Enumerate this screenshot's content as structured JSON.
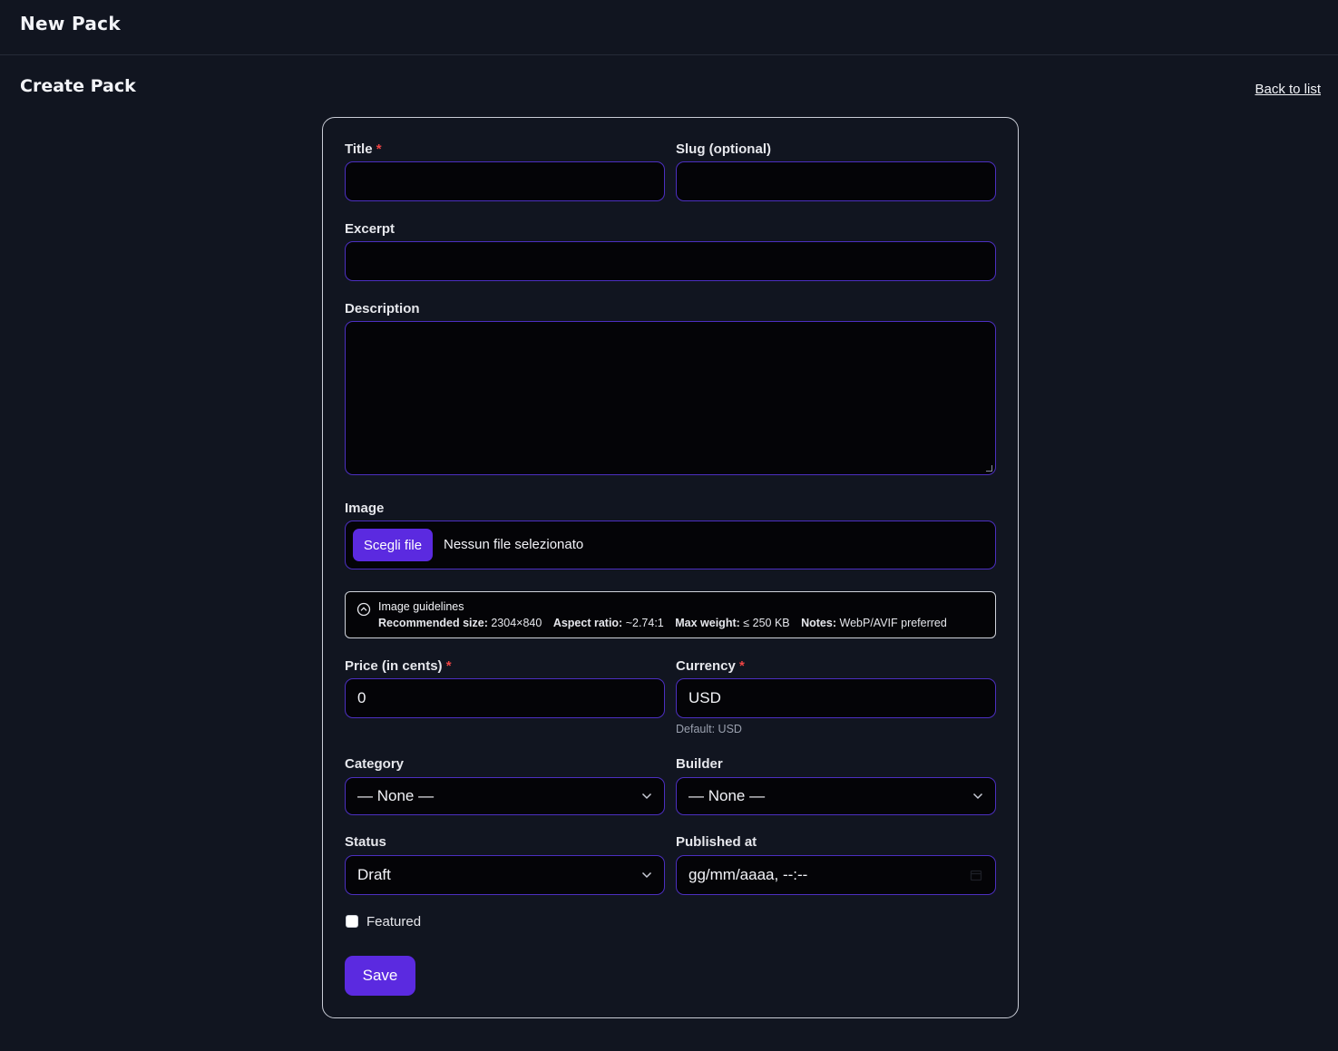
{
  "header": {
    "title": "New Pack"
  },
  "page": {
    "title": "Create Pack",
    "back_link": "Back to list"
  },
  "form": {
    "title": {
      "label": "Title",
      "required_mark": "*",
      "value": ""
    },
    "slug": {
      "label": "Slug (optional)",
      "value": ""
    },
    "excerpt": {
      "label": "Excerpt",
      "value": ""
    },
    "description": {
      "label": "Description",
      "value": ""
    },
    "image": {
      "label": "Image",
      "button": "Scegli file",
      "status": "Nessun file selezionato"
    },
    "guidelines": {
      "title": "Image guidelines",
      "recommended_size_label": "Recommended size:",
      "recommended_size_value": "2304×840",
      "aspect_ratio_label": "Aspect ratio:",
      "aspect_ratio_value": "~2.74:1",
      "max_weight_label": "Max weight:",
      "max_weight_value": "≤ 250 KB",
      "notes_label": "Notes:",
      "notes_value": "WebP/AVIF preferred"
    },
    "price": {
      "label": "Price (in cents)",
      "required_mark": "*",
      "value": "0"
    },
    "currency": {
      "label": "Currency",
      "required_mark": "*",
      "value": "USD",
      "hint": "Default: USD"
    },
    "category": {
      "label": "Category",
      "selected": "— None —"
    },
    "builder": {
      "label": "Builder",
      "selected": "— None —"
    },
    "status": {
      "label": "Status",
      "selected": "Draft"
    },
    "published_at": {
      "label": "Published at",
      "placeholder": "gg/mm/aaaa, --:--"
    },
    "featured": {
      "label": "Featured",
      "checked": false
    },
    "save_label": "Save"
  },
  "colors": {
    "background": "#111520",
    "field_bg": "#040407",
    "field_border": "#4c2fc0",
    "accent": "#5b2ae0",
    "required": "#ef4444"
  }
}
